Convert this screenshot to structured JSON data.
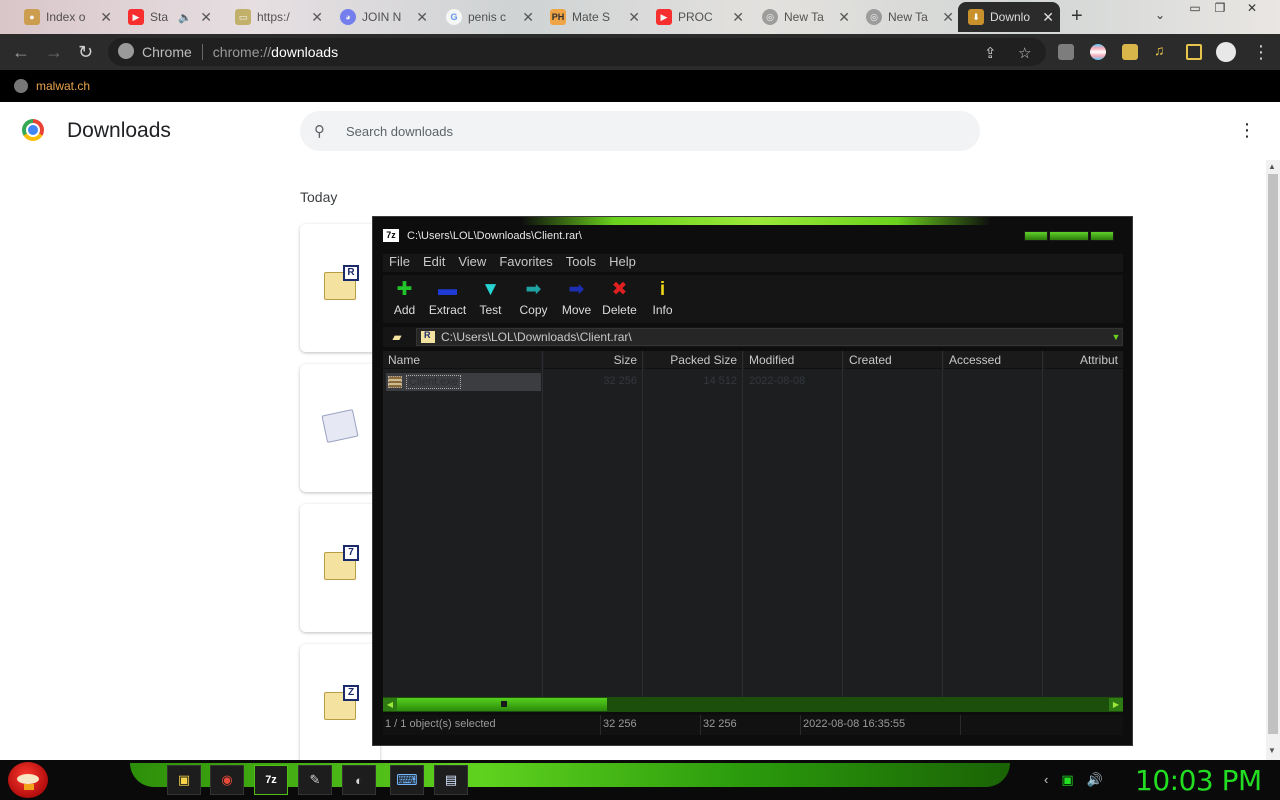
{
  "tabs": [
    {
      "title": "Index o",
      "icon": "pin-icon"
    },
    {
      "title": "Sta",
      "icon": "youtube-icon"
    },
    {
      "title": "https:/",
      "icon": "page-icon"
    },
    {
      "title": "JOIN N",
      "icon": "discord-icon"
    },
    {
      "title": "penis c",
      "icon": "google-icon"
    },
    {
      "title": "Mate S",
      "icon": "ph-icon",
      "favicon_text": "PH"
    },
    {
      "title": "PROC",
      "icon": "youtube-icon"
    },
    {
      "title": "New Ta",
      "icon": "chrome-icon"
    },
    {
      "title": "New Ta",
      "icon": "chrome-icon"
    },
    {
      "title": "Downlo",
      "icon": "download-icon",
      "active": true
    }
  ],
  "omnibox": {
    "site_label": "Chrome",
    "url_scheme": "chrome://",
    "url_host": "downloads"
  },
  "bookmarks": [
    {
      "label": "malwat.ch"
    }
  ],
  "downloads": {
    "title": "Downloads",
    "search_placeholder": "Search downloads",
    "section": "Today",
    "items": [
      {
        "badge": "R",
        "type": "rar"
      },
      {
        "badge": "",
        "type": "doc"
      },
      {
        "badge": "7",
        "type": "7z"
      },
      {
        "badge": "Z",
        "type": "zip"
      }
    ]
  },
  "sevenzip": {
    "logo_text": "7z",
    "window_title": "C:\\Users\\LOL\\Downloads\\Client.rar\\",
    "menu": [
      "File",
      "Edit",
      "View",
      "Favorites",
      "Tools",
      "Help"
    ],
    "toolbar": [
      {
        "label": "Add",
        "glyph": "+",
        "color": "#22c22a"
      },
      {
        "label": "Extract",
        "glyph": "▬",
        "color": "#1f3bd6"
      },
      {
        "label": "Test",
        "glyph": "▼",
        "color": "#27d3d3"
      },
      {
        "label": "Copy",
        "glyph": "➡",
        "color": "#1fa3a3"
      },
      {
        "label": "Move",
        "glyph": "➡",
        "color": "#1c2fb3"
      },
      {
        "label": "Delete",
        "glyph": "✖",
        "color": "#e02020"
      },
      {
        "label": "Info",
        "glyph": "i",
        "color": "#e8d21a"
      }
    ],
    "path": "C:\\Users\\LOL\\Downloads\\Client.rar\\",
    "path_icon_text": "R",
    "columns": [
      "Name",
      "Size",
      "Packed Size",
      "Modified",
      "Created",
      "Accessed",
      "Attribut"
    ],
    "rows": [
      {
        "name": "Client.exe",
        "size": "32 256",
        "packed": "14 512",
        "modified": "2022-08-08",
        "created": "",
        "accessed": "",
        "attributes": ""
      }
    ],
    "status": {
      "selection": "1 / 1 object(s) selected",
      "size": "32 256",
      "packed": "32 256",
      "datetime": "2022-08-08 16:35:55"
    }
  },
  "taskbar": {
    "apps": [
      {
        "name": "explorer-icon",
        "glyph": "▣"
      },
      {
        "name": "chrome-icon",
        "glyph": "◉"
      },
      {
        "name": "sevenzip-icon",
        "glyph": "7z",
        "active": true
      },
      {
        "name": "paint-icon",
        "glyph": "✎"
      },
      {
        "name": "speedometer-icon",
        "glyph": "◐"
      },
      {
        "name": "keyboard-icon",
        "glyph": "⌨"
      },
      {
        "name": "notepad-icon",
        "glyph": "▤"
      }
    ],
    "clock": "10:03 PM"
  }
}
